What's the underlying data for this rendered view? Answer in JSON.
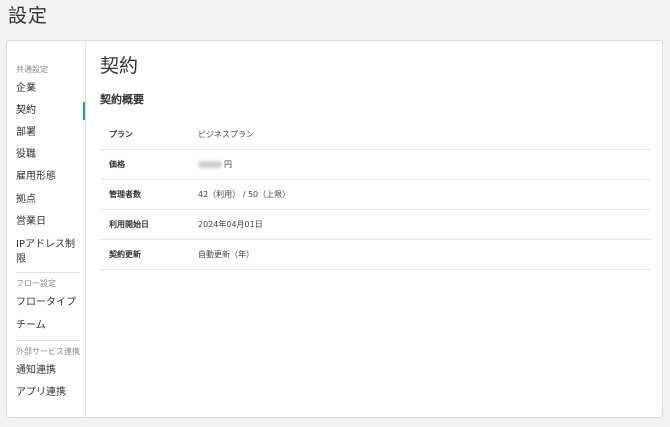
{
  "page": {
    "title": "設定"
  },
  "sidebar": {
    "sections": [
      {
        "label": "共通設定",
        "items": [
          "企業",
          "契約",
          "部署",
          "役職",
          "雇用形態",
          "拠点",
          "営業日",
          "IPアドレス制限"
        ]
      },
      {
        "label": "フロー設定",
        "items": [
          "フロータイプ",
          "チーム"
        ]
      },
      {
        "label": "外部サービス連携",
        "items": [
          "通知連携",
          "アプリ連携"
        ]
      }
    ],
    "active_item": "契約",
    "active_color": "#14a87d"
  },
  "main": {
    "title": "契約",
    "section_title": "契約概要",
    "rows": [
      {
        "key": "プラン",
        "value": "ビジネスプラン"
      },
      {
        "key": "価格",
        "value": "円",
        "blurred_prefix": true
      },
      {
        "key": "管理者数",
        "value": "42（利用） / 50（上限）"
      },
      {
        "key": "利用開始日",
        "value": "2024年04月01日"
      },
      {
        "key": "契約更新",
        "value": "自動更新（年）"
      }
    ]
  }
}
